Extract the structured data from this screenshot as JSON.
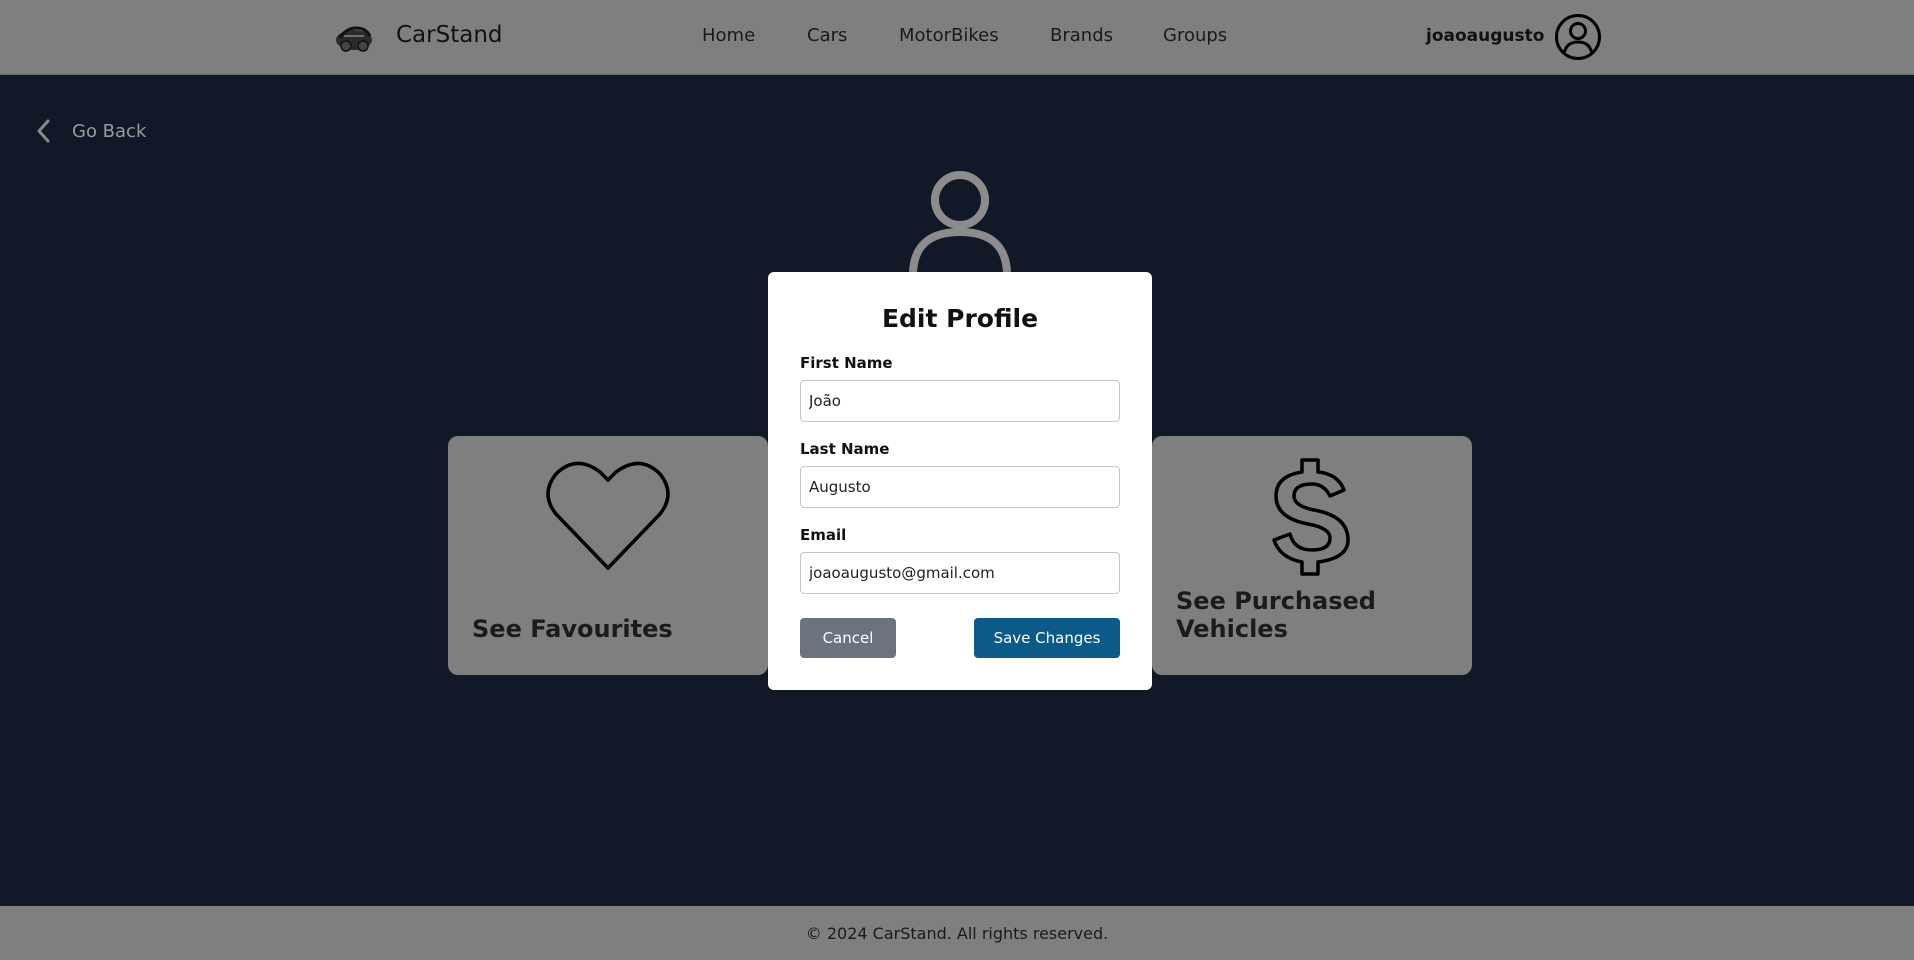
{
  "header": {
    "brand": "CarStand",
    "nav": [
      "Home",
      "Cars",
      "MotorBikes",
      "Brands",
      "Groups"
    ],
    "username": "joaoaugusto"
  },
  "page": {
    "go_back": "Go Back",
    "cards": [
      {
        "label": "See Favourites",
        "icon": "heart-icon"
      },
      {
        "label": "See Purchased Vehicles",
        "icon": "dollar-icon"
      }
    ]
  },
  "modal": {
    "title": "Edit Profile",
    "fields": [
      {
        "label": "First Name",
        "value": "João"
      },
      {
        "label": "Last Name",
        "value": "Augusto"
      },
      {
        "label": "Email",
        "value": "joaoaugusto@gmail.com"
      }
    ],
    "cancel_label": "Cancel",
    "save_label": "Save Changes"
  },
  "footer": {
    "text": "© 2024 CarStand. All rights reserved."
  },
  "colors": {
    "background": "#111827",
    "header_footer": "#7f7f7f",
    "save_button": "#0b5a88",
    "cancel_button": "#6b7280"
  }
}
